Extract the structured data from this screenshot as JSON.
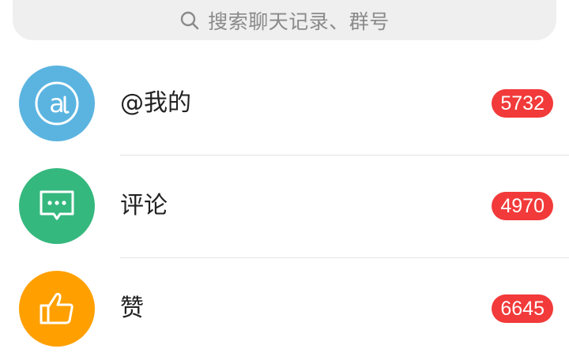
{
  "search": {
    "placeholder": "搜索聊天记录、群号",
    "icon": "search-icon"
  },
  "rows": [
    {
      "label": "@我的",
      "count": "5732",
      "icon": "at-sign-icon",
      "icon_bg": "#5bb4e0"
    },
    {
      "label": "评论",
      "count": "4970",
      "icon": "comment-bubble-icon",
      "icon_bg": "#35b87e"
    },
    {
      "label": "赞",
      "count": "6645",
      "icon": "thumbs-up-icon",
      "icon_bg": "#ffa000"
    }
  ],
  "colors": {
    "badge": "#f23a3a",
    "search_bg": "#efefef"
  }
}
